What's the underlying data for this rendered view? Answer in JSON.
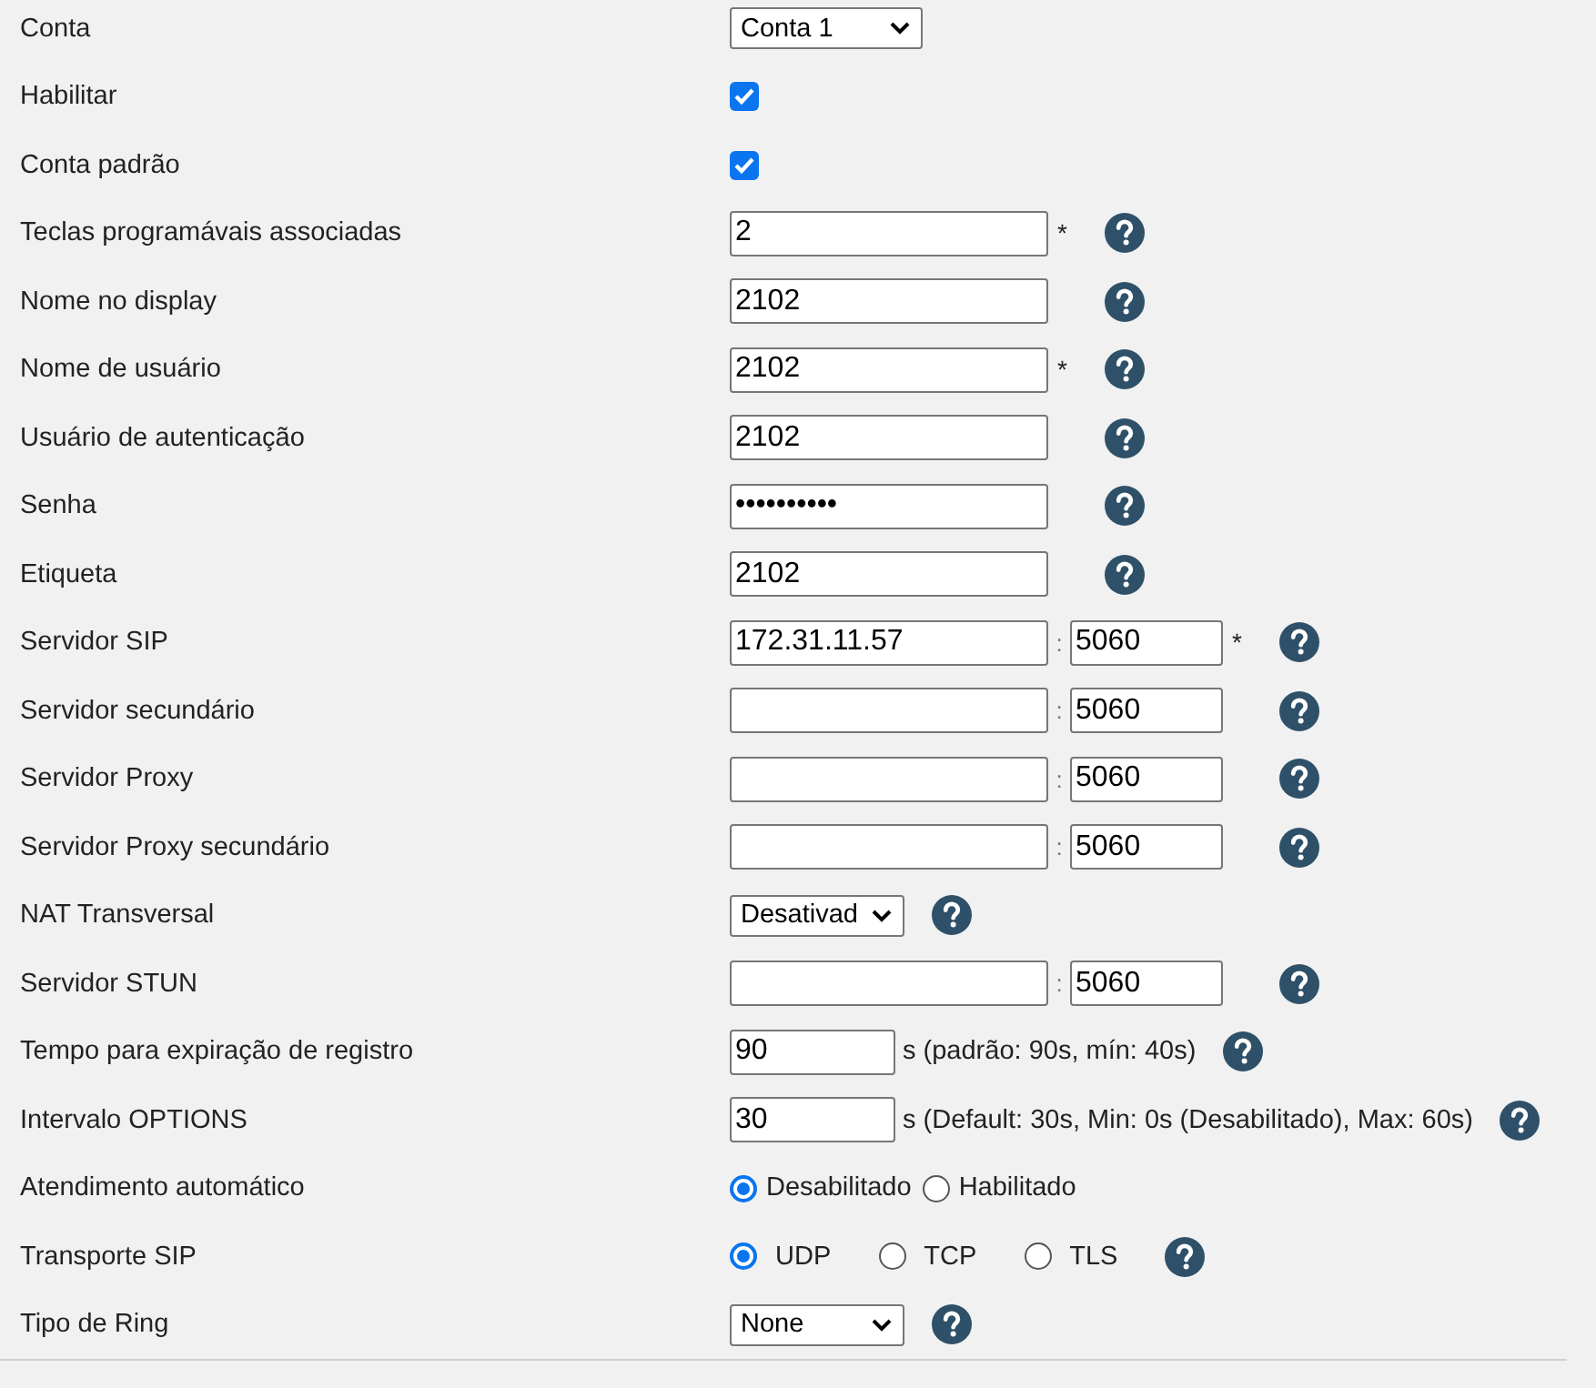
{
  "rows": [
    {
      "label": "Conta",
      "kind": "select",
      "value": "Conta 1",
      "help": false
    },
    {
      "label": "Habilitar",
      "kind": "checkbox",
      "checked": true
    },
    {
      "label": "Conta padrão",
      "kind": "checkbox",
      "checked": true
    },
    {
      "label": "Teclas programávais associadas",
      "kind": "text",
      "value": "2",
      "required_mark": "*",
      "help": true
    },
    {
      "label": "Nome no display",
      "kind": "text",
      "value": "2102",
      "help": true
    },
    {
      "label": "Nome de usuário",
      "kind": "text",
      "value": "2102",
      "required_mark": "*",
      "help": true
    },
    {
      "label": "Usuário de autenticação",
      "kind": "text",
      "value": "2102",
      "help": true
    },
    {
      "label": "Senha",
      "kind": "text",
      "value": "••••••••••",
      "help": true
    },
    {
      "label": "Etiqueta",
      "kind": "text",
      "value": "2102",
      "help": true
    },
    {
      "label": "Servidor SIP",
      "kind": "text",
      "value": "172.31.11.57",
      "separator": ":",
      "port": "5060",
      "required_mark": "*",
      "help": true
    },
    {
      "label": "Servidor secundário",
      "kind": "text",
      "value": "",
      "separator": ":",
      "port": "5060",
      "help": true
    },
    {
      "label": "Servidor Proxy",
      "kind": "text",
      "value": "",
      "separator": ":",
      "port": "5060",
      "help": true
    },
    {
      "label": "Servidor Proxy secundário",
      "kind": "text",
      "value": "",
      "separator": ":",
      "port": "5060",
      "help": true
    },
    {
      "label": "NAT Transversal",
      "kind": "select",
      "value": "Desativad",
      "help": true
    },
    {
      "label": "Servidor STUN",
      "kind": "text",
      "value": "",
      "separator": ":",
      "port": "5060",
      "help": true
    },
    {
      "label": "Tempo para expiração de registro",
      "kind": "text",
      "value": "90",
      "note": "s (padrão: 90s, mín: 40s)",
      "help": true
    },
    {
      "label": "Intervalo OPTIONS",
      "kind": "text",
      "value": "30",
      "note": "s (Default: 30s, Min: 0s (Desabilitado), Max: 60s)",
      "help": true
    },
    {
      "label": "Atendimento automático",
      "kind": "radio",
      "spread": false,
      "options": [
        {
          "label": "Desabilitado",
          "selected": true
        },
        {
          "label": "Habilitado",
          "selected": false
        }
      ],
      "help": false
    },
    {
      "label": "Transporte SIP",
      "kind": "radio",
      "spread": true,
      "options": [
        {
          "label": "UDP",
          "selected": true
        },
        {
          "label": "TCP",
          "selected": false
        },
        {
          "label": "TLS",
          "selected": false
        }
      ],
      "help": true
    },
    {
      "label": "Tipo de Ring",
      "kind": "select",
      "value": "None",
      "help": true
    }
  ]
}
